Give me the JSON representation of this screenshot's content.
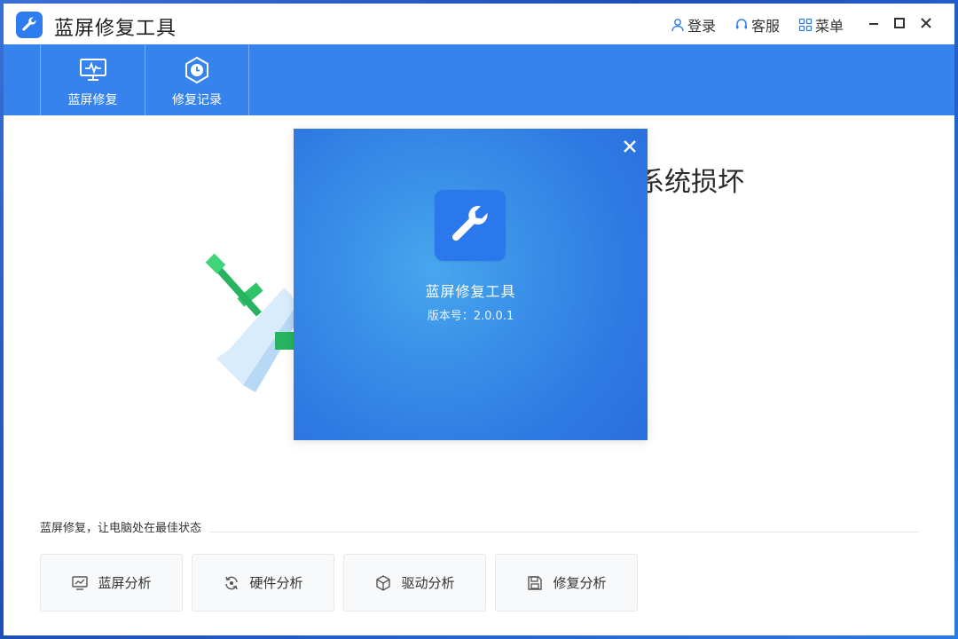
{
  "app": {
    "title": "蓝屏修复工具"
  },
  "titlebar": {
    "login_label": "登录",
    "service_label": "客服",
    "menu_label": "菜单"
  },
  "nav": {
    "tabs": [
      {
        "label": "蓝屏修复",
        "icon": "monitor-pulse-icon"
      },
      {
        "label": "修复记录",
        "icon": "clock-hexagon-icon"
      }
    ]
  },
  "main": {
    "headline_visible": "系统损坏",
    "caption": "蓝屏修复，让电脑处在最佳状态",
    "features": [
      {
        "label": "蓝屏分析",
        "icon": "monitor-chart-icon"
      },
      {
        "label": "硬件分析",
        "icon": "refresh-cycle-icon"
      },
      {
        "label": "驱动分析",
        "icon": "cube-icon"
      },
      {
        "label": "修复分析",
        "icon": "save-disk-icon"
      }
    ]
  },
  "modal": {
    "title": "蓝屏修复工具",
    "version": "版本号：2.0.0.1"
  },
  "colors": {
    "brand": "#3683ee",
    "accent_green": "#2ecc71"
  }
}
